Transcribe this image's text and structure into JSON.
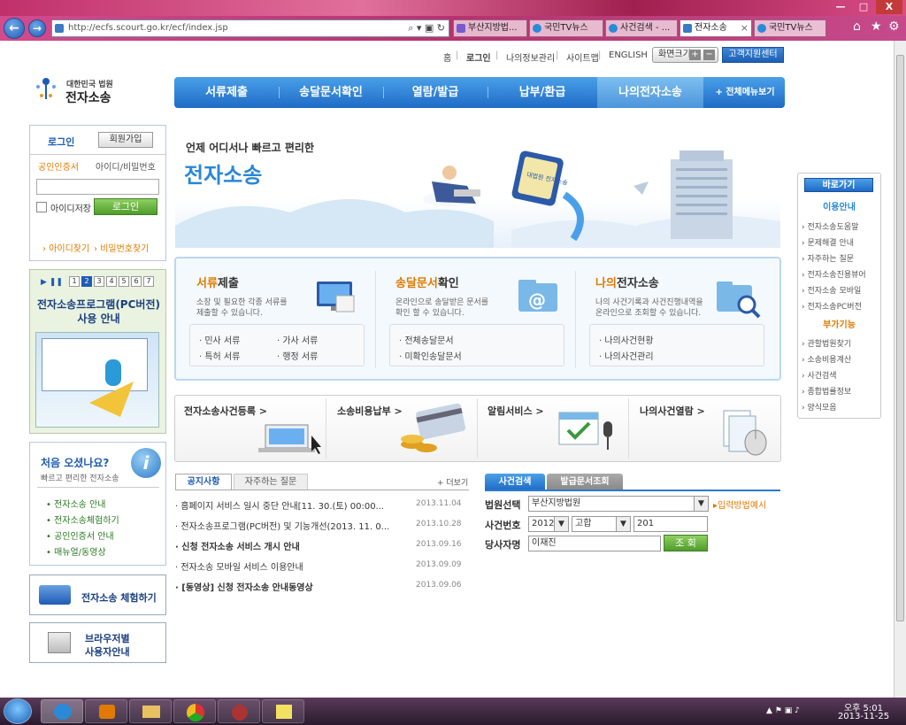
{
  "window": {
    "minimize": "—",
    "maximize": "□",
    "close": "X"
  },
  "browser": {
    "address": "http://ecfs.scourt.go.kr/ecf/index.jsp",
    "tabs": [
      {
        "label": "부산지방법..."
      },
      {
        "label": "국민TV뉴스"
      },
      {
        "label": "사건검색 - ..."
      },
      {
        "label": "전자소송"
      },
      {
        "label": "국민TV뉴스"
      }
    ],
    "tab_close": "×"
  },
  "toplinks": {
    "home": "홈",
    "login": "로그인",
    "myinfo": "나의정보관리",
    "sitemap": "사이트맵",
    "english": "ENGLISH",
    "zoom_label": "화면크기",
    "zoom_plus": "+",
    "zoom_minus": "−",
    "support": "고객지원센터",
    "sep": "|"
  },
  "logo": {
    "small": "대한민국 법원",
    "big": "전자소송"
  },
  "gnb": {
    "items": [
      "서류제출",
      "송달문서확인",
      "열람/발급",
      "납부/환급",
      "나의전자소송"
    ],
    "all_menu": "+ 전체메뉴보기"
  },
  "login": {
    "tab_login": "로그인",
    "join": "회원가입",
    "tab_cert": "공인인증서",
    "tab_id": "아이디/비밀번호",
    "save_id": "아이디저장",
    "login_btn": "로그인",
    "find_id": "아이디찾기",
    "find_pw": "비밀번호찾기"
  },
  "banner": {
    "pages": [
      "1",
      "2",
      "3",
      "4",
      "5",
      "6",
      "7"
    ],
    "title1": "전자소송프로그램(PC버전)",
    "title2": "사용 안내"
  },
  "first": {
    "title": "처음 오셨나요?",
    "sub": "빠르고 편리한 전자소송",
    "links": [
      "전자소송 안내",
      "전자소송체험하기",
      "공인인증서 안내",
      "매뉴얼/동영상"
    ]
  },
  "side_buttons": {
    "trial": "전자소송 체험하기",
    "browser1": "브라우저별",
    "browser2": "사용자안내"
  },
  "hero": {
    "line1": "언제 어디서나 빠르고 편리한",
    "line2": "전자소송",
    "monitor_text": "대법원 전자소송"
  },
  "cards": [
    {
      "title_a": "서류",
      "title_b": "제출",
      "desc1": "소장 및 필요한 각종 서류를",
      "desc2": "제출할 수 있습니다.",
      "items": [
        "· 민사 서류",
        "· 가사 서류",
        "· 특허 서류",
        "· 행정 서류"
      ]
    },
    {
      "title_a": "송달문서",
      "title_b": "확인",
      "desc1": "온라인으로 송달받은 문서를",
      "desc2": "확인 할 수 있습니다.",
      "items": [
        "· 전체송달문서",
        "· 미확인송달문서"
      ]
    },
    {
      "title_a": "나의",
      "title_b": "전자소송",
      "desc1": "나의 사건기록과 사건진행내역을",
      "desc2": "온라인으로 조회할 수 있습니다.",
      "items": [
        "· 나의사건현황",
        "· 나의사건관리"
      ]
    }
  ],
  "services": [
    "전자소송사건등록 >",
    "소송비용납부 >",
    "알림서비스 >",
    "나의사건열람 >"
  ],
  "notice": {
    "tab1": "공지사항",
    "tab2": "자주하는 질문",
    "more": "+ 더보기",
    "rows": [
      {
        "title": "· 홈페이지 서비스 일시 중단 안내[11. 30.(토) 00:00...",
        "date": "2013.11.04"
      },
      {
        "title": "· 전자소송프로그램(PC버전) 및 기능개선(2013. 11. 0...",
        "date": "2013.10.28"
      },
      {
        "title": "· 신청 전자소송 서비스 개시 안내",
        "date": "2013.09.16"
      },
      {
        "title": "· 전자소송 모바일 서비스 이용안내",
        "date": "2013.09.09"
      },
      {
        "title": "· [동영상] 신청 전자소송 안내동영상",
        "date": "2013.09.06"
      }
    ]
  },
  "search": {
    "tab1": "사건검색",
    "tab2": "발급문서조회",
    "court_label": "법원선택",
    "court_value": "부산지방법원",
    "example": "▸입력방법예시",
    "caseno_label": "사건번호",
    "year": "2012",
    "kind": "고합",
    "number": "201",
    "party_label": "당사자명",
    "party_value": "이재진",
    "search_btn": "조 회"
  },
  "quick": {
    "title": "바로가기",
    "sec1": "이용안내",
    "sec1_items": [
      "전자소송도움말",
      "문제해결 안내",
      "자주하는 질문",
      "전자소송진용뷰어",
      "전자소송 모바일",
      "전자소송PC버전"
    ],
    "sec2": "부가기능",
    "sec2_items": [
      "관할법원찾기",
      "소송비용계산",
      "사건검색",
      "종합법률정보",
      "양식모음"
    ]
  },
  "taskbar": {
    "ampm_time": "오후 5:01",
    "date": "2013-11-25"
  }
}
